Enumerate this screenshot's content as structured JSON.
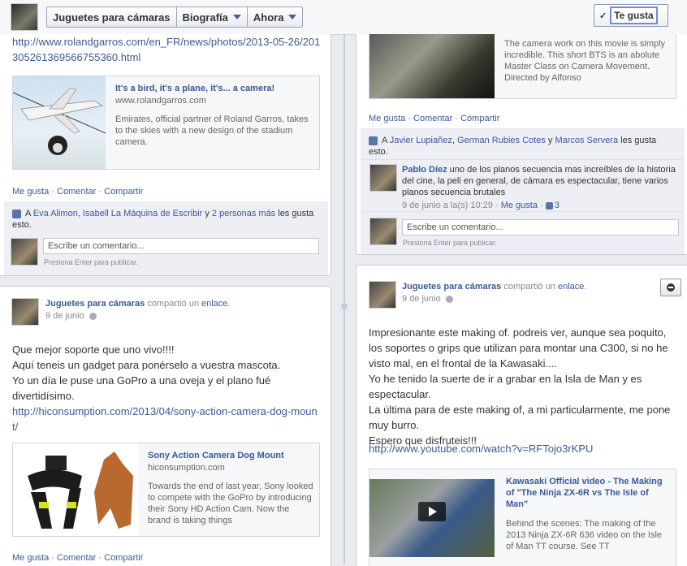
{
  "header": {
    "crumbs": [
      "Juguetes para cámaras",
      "Biografía",
      "Ahora"
    ],
    "like_button": "Te gusta",
    "like_check": "✓"
  },
  "post_lt": {
    "link": "http://www.rolandgarros.com/en_FR/news/photos/2013-05-26/20130526136956675536​0.html",
    "attach_title": "It's a bird, it's a plane, it's... a camera!",
    "attach_host": "www.rolandgarros.com",
    "attach_desc": "Emirates, official partner of Roland Garros, takes to the skies with a new design of the stadium camera.",
    "actions": [
      "Me gusta",
      "Comentar",
      "Compartir"
    ],
    "likes_prefix": "A ",
    "likes_names": "Eva Alimon, Isabell La Máquina de Escribir",
    "likes_and": " y ",
    "likes_more": "2 personas más",
    "likes_suffix": " les gusta esto.",
    "comment_placeholder": "Escribe un comentario...",
    "comment_hint": "Presiona Enter para publicar."
  },
  "post_rt": {
    "attach_desc": "The camera work on this movie is simply incredible. This short BTS is an abolute Master Class on Camera Movement. Directed by Alfonso",
    "actions": [
      "Me gusta",
      "Comentar",
      "Compartir"
    ],
    "likes_prefix": "A ",
    "likes_n1": "Javier Lupiañez",
    "likes_sep": ", ",
    "likes_n2": "German Rubies Cotes",
    "likes_and": " y ",
    "likes_n3": "Marcos Servera",
    "likes_suffix": " les gusta esto.",
    "comment_author": "Pablo Díez",
    "comment_text": " uno de los planos secuencia mas increíbles de la historia del cine, la peli en general, de cámara es espectacular, tiene varios planos secuencia brutales",
    "comment_time": "9 de junio a la(s) 10:29",
    "comment_like": "Me gusta",
    "comment_likes": "3",
    "comment_placeholder": "Escribe un comentario...",
    "comment_hint": "Presiona Enter para publicar."
  },
  "post_lb": {
    "author": "Juguetes para cámaras",
    "verb": " compartió un ",
    "object": "enlace",
    "date": "9 de junio",
    "text_lines": [
      "Que mejor soporte que uno vivo!!!!",
      "Aquí teneis un gadget para ponérselo a vuestra mascota.",
      "Yo un día le puse una GoPro a una oveja y el plano fué divertidísimo."
    ],
    "link": "http://hiconsumption.com/2013/04/sony-action-camera-dog-mount/",
    "attach_title": "Sony Action Camera Dog Mount",
    "attach_host": "hiconsumption.com",
    "attach_desc": "Towards the end of last year, Sony looked to compete with the GoPro by introducing their Sony HD Action Cam. Now the brand is taking things",
    "actions": [
      "Me gusta",
      "Comentar",
      "Compartir"
    ]
  },
  "post_rb": {
    "author": "Juguetes para cámaras",
    "verb": " compartió un ",
    "object": "enlace",
    "date": "9 de junio",
    "text": "Impresionante este making of. podreis ver, aunque sea poquito, los soportes o grips que utilizan para montar una C300, si no he visto mal, en el frontal de la Kawasaki....\nYo he tenido la suerte de ir a grabar en la Isla de Man y es espectacular.\nLa última para de este making of, a mi particularmente, me pone muy burro.\nEspero que disfruteis!!!",
    "link": "http://www.youtube.com/watch?v=RFTojo3rKPU",
    "attach_title": "Kawasaki Official video - The Making of \"The Ninja ZX-6R vs The Isle of Man\"",
    "attach_desc": "Behind the scenes: The making of the 2013 Ninja ZX-6R 636 video on the Isle of Man TT course. See TT"
  }
}
